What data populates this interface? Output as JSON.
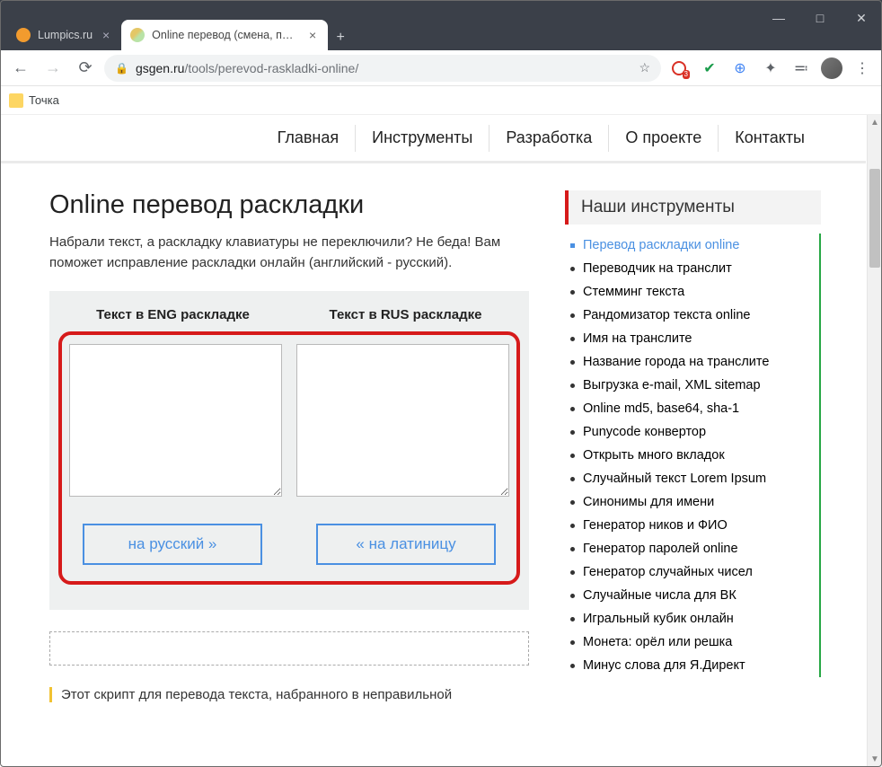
{
  "browser": {
    "tabs": [
      {
        "title": "Lumpics.ru",
        "active": false
      },
      {
        "title": "Online перевод (смена, перекл",
        "active": true
      }
    ],
    "url_domain": "gsgen.ru",
    "url_path": "/tools/perevod-raskladki-online/",
    "bookmark": "Точка"
  },
  "nav": {
    "items": [
      "Главная",
      "Инструменты",
      "Разработка",
      "О проекте",
      "Контакты"
    ]
  },
  "main": {
    "heading": "Online перевод раскладки",
    "lead": "Набрали текст, а раскладку клавиатуры не переключили? Не беда! Вам поможет исправление раскладки онлайн (английский - русский).",
    "col_eng_label": "Текст в ENG раскладке",
    "col_rus_label": "Текст в RUS раскладке",
    "btn_to_ru": "на русский »",
    "btn_to_lat": "« на латиницу",
    "eng_value": "",
    "rus_value": "",
    "footer_text": "Этот скрипт для перевода текста, набранного в неправильной"
  },
  "sidebar": {
    "heading": "Наши инструменты",
    "items": [
      "Перевод раскладки online",
      "Переводчик на транслит",
      "Стемминг текста",
      "Рандомизатор текста online",
      "Имя на транслите",
      "Название города на транслите",
      "Выгрузка e-mail, XML sitemap",
      "Online md5, base64, sha-1",
      "Punycode конвертор",
      "Открыть много вкладок",
      "Случайный текст Lorem Ipsum",
      "Синонимы для имени",
      "Генератор ников и ФИО",
      "Генератор паролей online",
      "Генератор случайных чисел",
      "Случайные числа для ВК",
      "Игральный кубик онлайн",
      "Монета: орёл или решка",
      "Минус слова для Я.Директ"
    ],
    "active_index": 0
  }
}
